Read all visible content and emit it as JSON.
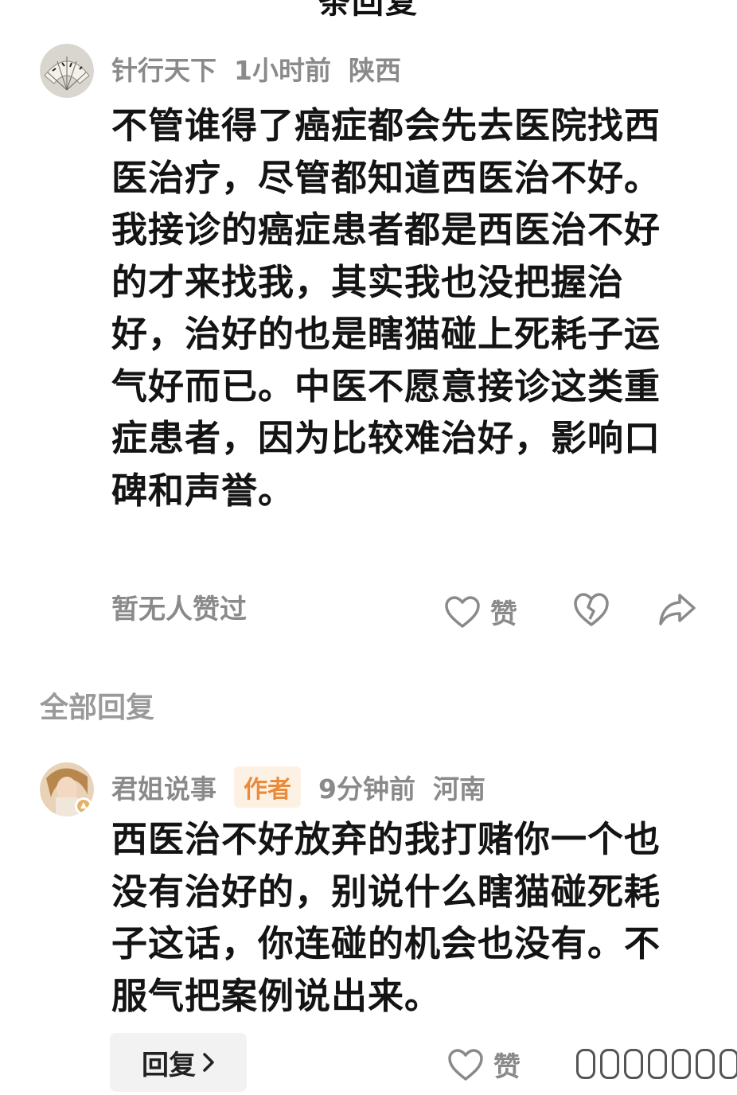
{
  "header": {
    "title": "条回复"
  },
  "main_comment": {
    "username": "针行天下",
    "time": "1小时前",
    "location": "陕西",
    "paragraphs": [
      "不管谁得了癌症都会先去医院找西医治疗，尽管都知道西医治不好。",
      "我接诊的癌症患者都是西医治不好的才来找我，其实我也没把握治好，治好的也是瞎猫碰上死耗子运气好而已。中医不愿意接诊这类重症患者，因为比较难治好，影响口碑和声誉。"
    ],
    "likes_status": "暂无人赞过",
    "like_label": "赞"
  },
  "replies_section": {
    "title": "全部回复"
  },
  "reply": {
    "username": "君姐说事",
    "badge": "作者",
    "time": "9分钟前",
    "location": "河南",
    "text": "西医治不好放弃的我打赌你一个也没有治好的，别说什么瞎猫碰死耗子这话，你连碰的机会也没有。不服气把案例说出来。",
    "reply_button": "回复",
    "like_label": "赞"
  },
  "icons": {
    "like": "heart-outline-icon",
    "dislike": "broken-heart-icon",
    "share": "share-arrow-icon",
    "chevron": "chevron-right-icon"
  },
  "colors": {
    "text_primary": "#141414",
    "text_secondary": "#8a8a8a",
    "badge_bg": "#fdf1e4",
    "badge_text": "#e98b3a",
    "reply_button_bg": "#f2f2f2"
  }
}
